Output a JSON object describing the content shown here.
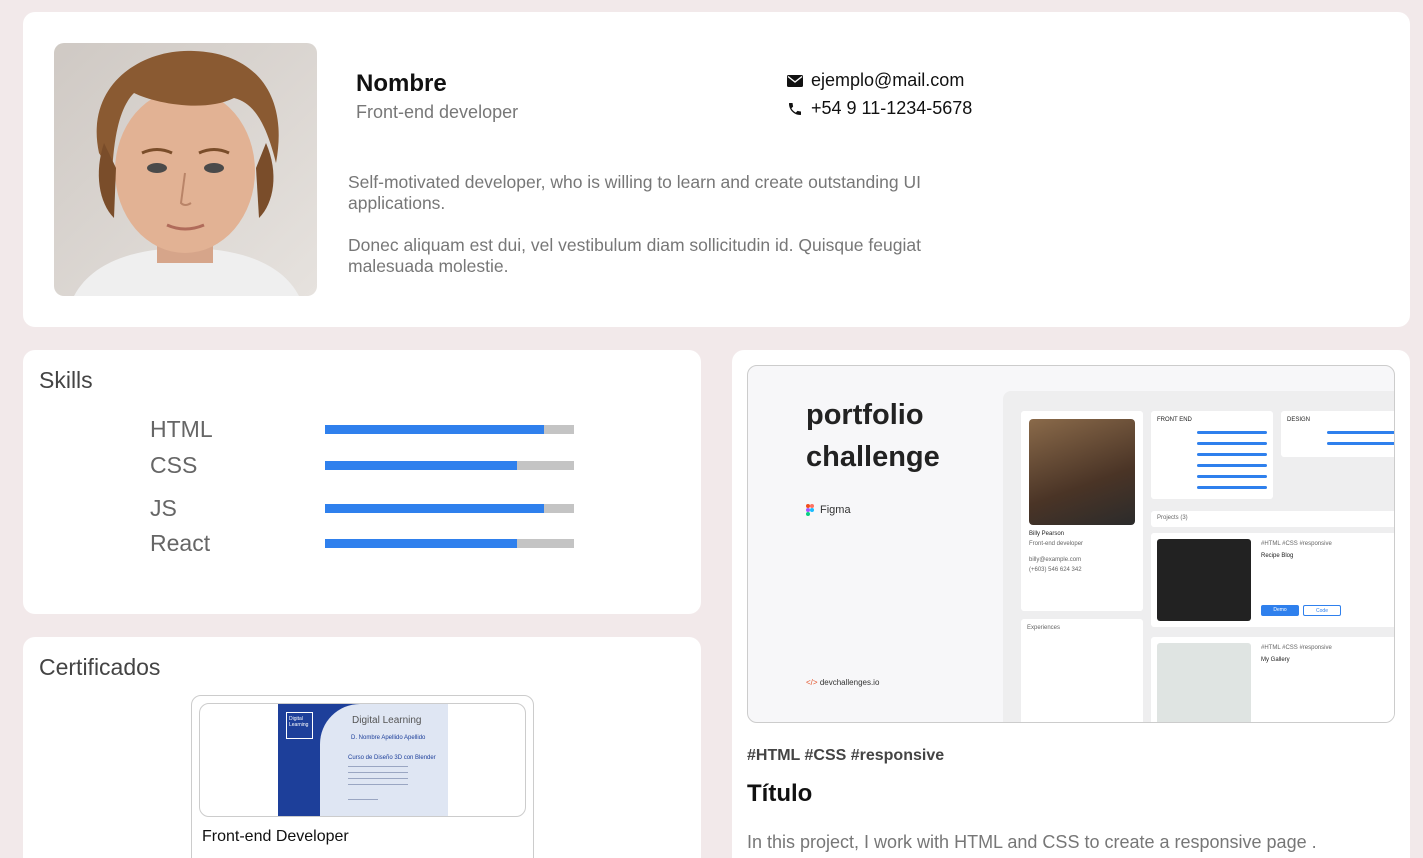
{
  "profile": {
    "name": "Nombre",
    "role": "Front-end developer",
    "email": "ejemplo@mail.com",
    "phone": "+54 9 11-1234-5678",
    "bio_1": "Self-motivated developer, who is willing to learn and create outstanding UI applications.",
    "bio_2": "Donec aliquam est dui, vel vestibulum diam sollicitudin id. Quisque feugiat malesuada molestie."
  },
  "skills": {
    "title": "Skills",
    "items": [
      {
        "name": "HTML",
        "level": 0.88
      },
      {
        "name": "CSS",
        "level": 0.77
      },
      {
        "name": "JS",
        "level": 0.88
      },
      {
        "name": "React",
        "level": 0.77
      }
    ],
    "bar_color": "#2f80ed",
    "track_color": "#c4c4c4"
  },
  "certificates": {
    "title": "Certificados",
    "items": [
      {
        "title": "Front-end Developer",
        "image_text": {
          "logo": "Digital Learning",
          "heading": "Digital Learning",
          "recipient": "D. Nombre Apellido Apellido",
          "course": "Curso de Diseño 3D con Blender"
        }
      }
    ]
  },
  "project": {
    "image_text": {
      "title": "portfolio challenge",
      "tool": "Figma",
      "site": "devchallenges.io",
      "mock_name": "Billy Pearson",
      "mock_role": "Front-end developer",
      "mock_email": "billy@example.com",
      "mock_phone": "(+603) 546 624 342",
      "mock_front_end": "FRONT END",
      "mock_design": "DESIGN",
      "mock_projects": "Projects (3)",
      "mock_experiences": "Experiences",
      "mock_project_1": "Recipe Blog",
      "mock_project_2": "My Gallery",
      "mock_tags": "#HTML #CSS #responsive",
      "mock_demo": "Demo",
      "mock_code": "Code"
    },
    "tags": "#HTML #CSS #responsive",
    "title": "Título",
    "description": "In this project, I work with HTML and CSS to create a responsive page ."
  },
  "colors": {
    "background": "#f2e9ea",
    "accent": "#2f80ed"
  }
}
